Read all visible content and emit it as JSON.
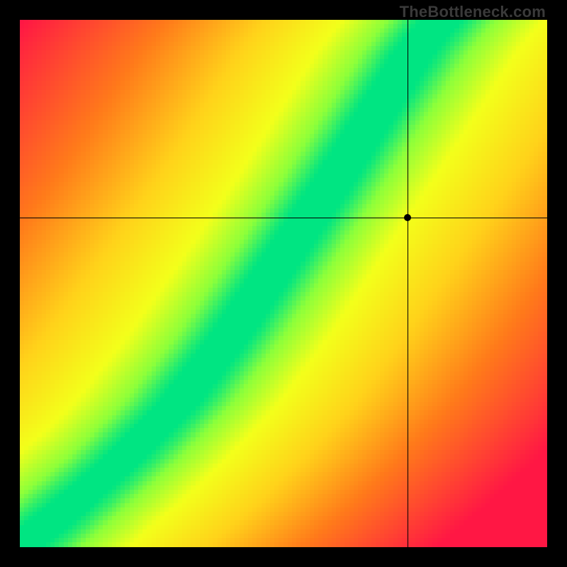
{
  "watermark": "TheBottleneck.com",
  "chart_data": {
    "type": "heatmap",
    "title": "",
    "xlabel": "",
    "ylabel": "",
    "xlim": [
      0,
      1
    ],
    "ylim": [
      0,
      1
    ],
    "grid": false,
    "legend": false,
    "marker": {
      "x": 0.735,
      "y": 0.625
    },
    "crosshair": {
      "x": 0.735,
      "y": 0.625
    },
    "optimal_curve": {
      "description": "Green ridge of optimal pairing; monotone increasing, slightly super-linear",
      "points": [
        {
          "x": 0.0,
          "y": 0.0
        },
        {
          "x": 0.1,
          "y": 0.08
        },
        {
          "x": 0.2,
          "y": 0.17
        },
        {
          "x": 0.3,
          "y": 0.27
        },
        {
          "x": 0.4,
          "y": 0.4
        },
        {
          "x": 0.5,
          "y": 0.55
        },
        {
          "x": 0.6,
          "y": 0.7
        },
        {
          "x": 0.7,
          "y": 0.86
        },
        {
          "x": 0.75,
          "y": 0.94
        },
        {
          "x": 0.8,
          "y": 1.0
        }
      ]
    },
    "color_stops": [
      {
        "t": 0.0,
        "color": "#ff1744"
      },
      {
        "t": 0.35,
        "color": "#ff7a1a"
      },
      {
        "t": 0.6,
        "color": "#ffd21a"
      },
      {
        "t": 0.8,
        "color": "#f3ff1a"
      },
      {
        "t": 0.92,
        "color": "#8cff3a"
      },
      {
        "t": 1.0,
        "color": "#00e582"
      }
    ],
    "resolution": 120
  }
}
